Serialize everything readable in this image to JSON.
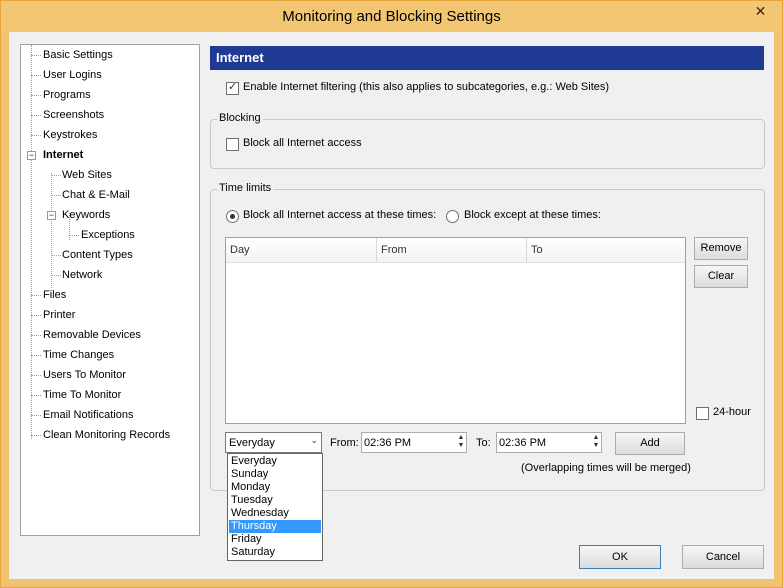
{
  "window": {
    "title": "Monitoring and Blocking Settings",
    "close_glyph": "✕"
  },
  "tree": {
    "items": [
      {
        "label": "Basic Settings"
      },
      {
        "label": "User Logins"
      },
      {
        "label": "Programs"
      },
      {
        "label": "Screenshots"
      },
      {
        "label": "Keystrokes"
      },
      {
        "label": "Internet",
        "selected": true,
        "expanded": true
      },
      {
        "label": "Web Sites"
      },
      {
        "label": "Chat & E-Mail"
      },
      {
        "label": "Keywords",
        "expanded": true
      },
      {
        "label": "Exceptions"
      },
      {
        "label": "Content Types"
      },
      {
        "label": "Network"
      },
      {
        "label": "Files"
      },
      {
        "label": "Printer"
      },
      {
        "label": "Removable Devices"
      },
      {
        "label": "Time Changes"
      },
      {
        "label": "Users To Monitor"
      },
      {
        "label": "Time To Monitor"
      },
      {
        "label": "Email Notifications"
      },
      {
        "label": "Clean Monitoring Records"
      }
    ]
  },
  "panel": {
    "header": "Internet",
    "enable_filtering": {
      "label": "Enable Internet filtering (this also applies to subcategories, e.g.: Web Sites)",
      "checked": true
    },
    "blocking": {
      "title": "Blocking",
      "block_all": {
        "label": "Block all Internet access",
        "checked": false
      }
    },
    "time_limits": {
      "title": "Time limits",
      "radio_block_at": {
        "label": "Block all Internet access at these times:",
        "selected": true
      },
      "radio_block_except": {
        "label": "Block except at these times:",
        "selected": false
      },
      "columns": [
        "Day",
        "From",
        "To"
      ],
      "remove_label": "Remove",
      "clear_label": "Clear",
      "hour24": {
        "label": "24-hour",
        "checked": false
      },
      "day_value": "Everyday",
      "from_label": "From:",
      "from_value": "02:36 PM",
      "to_label": "To:",
      "to_value": "02:36 PM",
      "add_label": "Add",
      "note": "(Overlapping times will be merged)",
      "day_options": [
        "Everyday",
        "Sunday",
        "Monday",
        "Tuesday",
        "Wednesday",
        "Thursday",
        "Friday",
        "Saturday"
      ],
      "day_highlighted": "Thursday"
    }
  },
  "footer": {
    "ok_label": "OK",
    "cancel_label": "Cancel"
  },
  "colors": {
    "titlebar": "#f3c673",
    "header_bg": "#1f3a93",
    "selection": "#3399ff"
  }
}
